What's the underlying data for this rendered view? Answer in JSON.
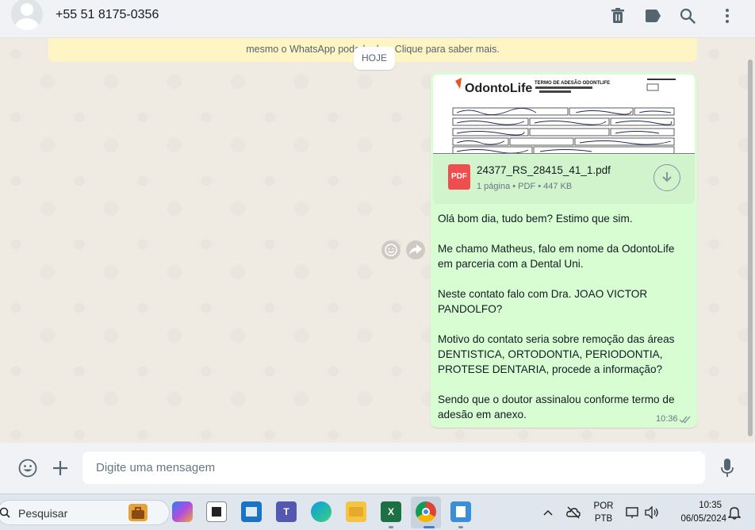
{
  "header": {
    "contact": "+55 51 8175-0356",
    "icons": [
      "trash-icon",
      "label-icon",
      "search-icon",
      "menu-dots-icon"
    ]
  },
  "notice": {
    "text": "mesmo o WhatsApp pode le        -las. Clique para saber mais."
  },
  "date_chip": "HOJE",
  "message": {
    "attachment": {
      "filename": "24377_RS_28415_41_1.pdf",
      "meta": "1 página • PDF • 447 KB",
      "badge": "PDF",
      "preview_title": "TERMO DE ADESÃO ODONTLIFE",
      "preview_logo": "OdontoLife"
    },
    "text": "Olá bom dia, tudo bem? Estimo que sim.\n\nMe chamo Matheus, falo em nome da OdontoLife em parceria com a Dental Uni.\n\nNeste contato falo com Dra. JOAO VICTOR PANDOLFO?\n\nMotivo do contato seria sobre remoção das áreas DENTISTICA, ORTODONTIA, PERIODONTIA, PROTESE DENTARIA, procede a informação?\n\nSendo que o doutor assinalou conforme termo de adesão em anexo.",
    "time": "10:36"
  },
  "composer": {
    "placeholder": "Digite uma mensagem"
  },
  "taskbar": {
    "search_label": "Pesquisar",
    "lang_top": "POR",
    "lang_bottom": "PTB",
    "clock_time": "10:35",
    "clock_date": "06/05/2024"
  }
}
